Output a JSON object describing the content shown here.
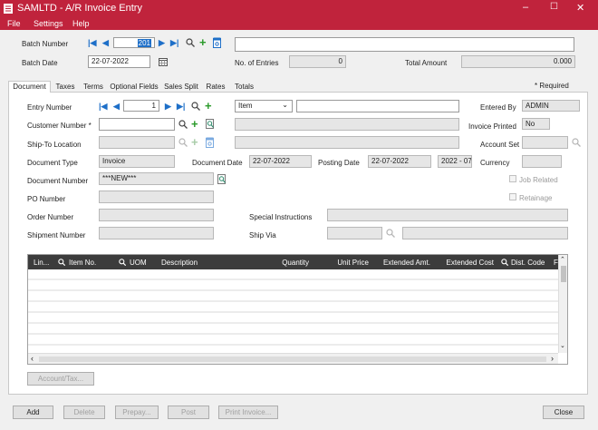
{
  "window": {
    "title": "SAMLTD - A/R Invoice Entry",
    "min": "–",
    "max": "☐",
    "close": "✕"
  },
  "menu": {
    "file": "File",
    "settings": "Settings",
    "help": "Help"
  },
  "batch": {
    "number_label": "Batch Number",
    "number_value": "201",
    "description": "",
    "date_label": "Batch Date",
    "date_value": "22-07-2022",
    "entries_label": "No. of Entries",
    "entries_value": "0",
    "total_label": "Total Amount",
    "total_value": "0.000"
  },
  "tabs": [
    "Document",
    "Taxes",
    "Terms",
    "Optional Fields",
    "Sales Split",
    "Rates",
    "Totals"
  ],
  "required_note": "* Required",
  "doc": {
    "entry_label": "Entry Number",
    "entry_value": "1",
    "type_select": "Item",
    "entry_desc": "",
    "entered_by_label": "Entered By",
    "entered_by_value": "ADMIN",
    "customer_label": "Customer Number *",
    "customer_value": "",
    "customer_name": "",
    "invoice_printed_label": "Invoice Printed",
    "invoice_printed_value": "No",
    "shipto_label": "Ship-To Location",
    "shipto_value": "",
    "shipto_desc": "",
    "account_set_label": "Account Set",
    "account_set_value": "",
    "doc_type_label": "Document Type",
    "doc_type_value": "Invoice",
    "doc_date_label": "Document Date",
    "doc_date_value": "22-07-2022",
    "posting_date_label": "Posting Date",
    "posting_date_value": "22-07-2022",
    "period_value": "2022 - 07",
    "currency_label": "Currency",
    "currency_value": "",
    "doc_number_label": "Document Number",
    "doc_number_value": "***NEW***",
    "job_related_label": "Job Related",
    "po_label": "PO Number",
    "po_value": "",
    "retainage_label": "Retainage",
    "order_label": "Order Number",
    "order_value": "",
    "special_label": "Special Instructions",
    "special_value": "",
    "shipment_label": "Shipment Number",
    "shipment_value": "",
    "shipvia_label": "Ship Via",
    "shipvia_value": "",
    "shipvia_desc": ""
  },
  "grid": {
    "columns": [
      "Lin...",
      "Item No.",
      "UOM",
      "Description",
      "Quantity",
      "Unit Price",
      "Extended Amt.",
      "Extended Cost",
      "Dist. Code",
      "F"
    ],
    "rows": []
  },
  "buttons": {
    "account_tax": "Account/Tax...",
    "add": "Add",
    "delete": "Delete",
    "prepay": "Prepay...",
    "post": "Post",
    "print_invoice": "Print Invoice...",
    "close": "Close"
  },
  "colors": {
    "titlebar": "#c0233c",
    "grid_header": "#3c3c3c",
    "accent_blue": "#1e6fc8",
    "accent_green": "#2a9a2a"
  }
}
